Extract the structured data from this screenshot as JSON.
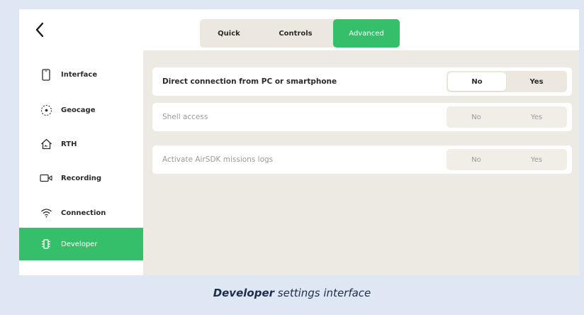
{
  "header": {
    "back_icon": "chevron-left-icon",
    "tabs": [
      {
        "label": "Quick"
      },
      {
        "label": "Controls"
      },
      {
        "label": "Advanced"
      }
    ],
    "active_tab": "Advanced"
  },
  "sidebar": {
    "items": [
      {
        "label": "Interface",
        "icon": "phone-icon"
      },
      {
        "label": "Geocage",
        "icon": "geocage-icon"
      },
      {
        "label": "RTH",
        "icon": "home-icon"
      },
      {
        "label": "Recording",
        "icon": "video-camera-icon"
      },
      {
        "label": "Connection",
        "icon": "wifi-icon"
      },
      {
        "label": "Developer",
        "icon": "chip-icon"
      }
    ],
    "active_item": "Developer"
  },
  "settings": [
    {
      "title": "Direct connection from PC or smartphone",
      "no_label": "No",
      "yes_label": "Yes",
      "selected": "No",
      "enabled": true
    },
    {
      "title": "Shell access",
      "no_label": "No",
      "yes_label": "Yes",
      "selected": "No",
      "enabled": false
    },
    {
      "title": "Activate AirSDK missions logs",
      "no_label": "No",
      "yes_label": "Yes",
      "selected": "No",
      "enabled": false
    }
  ],
  "caption": {
    "bold": "Developer",
    "rest": " settings interface"
  },
  "colors": {
    "accent": "#35bf6b",
    "content_bg": "#ede9e3",
    "page_bg": "#dfe7f4"
  }
}
